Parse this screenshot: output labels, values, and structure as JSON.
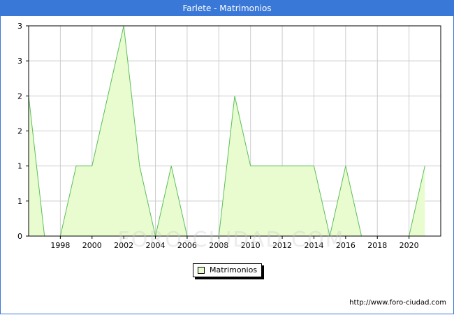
{
  "header": {
    "title": "Farlete - Matrimonios"
  },
  "watermark": "FORO-CIUDAD.COM",
  "footer": {
    "url": "http://www.foro-ciudad.com"
  },
  "colors": {
    "title_bar": "#3a78d8",
    "area_fill": "#e8fccf",
    "area_line": "#5bbf5b",
    "grid": "#cccccc"
  },
  "chart_data": {
    "type": "area",
    "title": "Farlete - Matrimonios",
    "xlabel": "",
    "ylabel": "",
    "x": [
      1996,
      1997,
      1998,
      1999,
      2000,
      2001,
      2002,
      2003,
      2004,
      2005,
      2006,
      2007,
      2008,
      2009,
      2010,
      2011,
      2012,
      2013,
      2014,
      2015,
      2016,
      2017,
      2018,
      2019,
      2020,
      2021
    ],
    "series": [
      {
        "name": "Matrimonios",
        "values": [
          2,
          0,
          0,
          1,
          1,
          2,
          3,
          1,
          0,
          1,
          0,
          0,
          0,
          2,
          1,
          1,
          1,
          1,
          1,
          0,
          1,
          0,
          0,
          0,
          0,
          1
        ]
      }
    ],
    "xlim": [
      1996,
      2022
    ],
    "ylim": [
      0,
      3
    ],
    "x_ticks": [
      "1998",
      "2000",
      "2002",
      "2004",
      "2006",
      "2008",
      "2010",
      "2012",
      "2014",
      "2016",
      "2018",
      "2020"
    ],
    "y_ticks": [
      "0",
      "1",
      "1",
      "2",
      "2",
      "3",
      "3"
    ],
    "grid": true,
    "legend_position": "bottom-center"
  }
}
